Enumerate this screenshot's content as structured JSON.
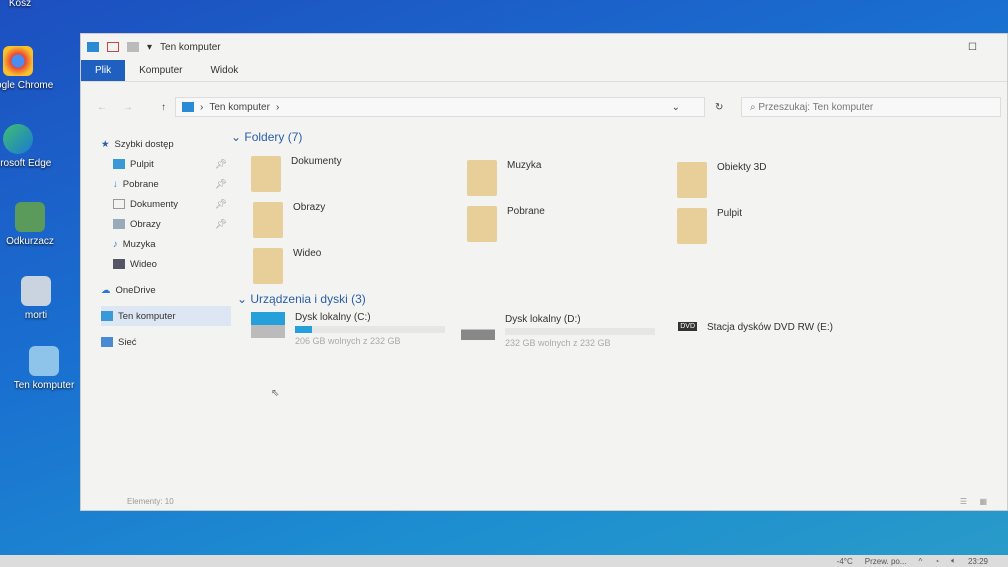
{
  "desktop": {
    "icons": [
      {
        "label": "Kosz"
      },
      {
        "label": "Google Chrome"
      },
      {
        "label": "Microsoft Edge"
      },
      {
        "label": "Odkurzacz"
      },
      {
        "label": "morti"
      },
      {
        "label": "Ten komputer"
      }
    ]
  },
  "window": {
    "title": "Ten komputer",
    "qa_dropdown": "▾",
    "ribbon": [
      "Plik",
      "Komputer",
      "Widok"
    ],
    "address": {
      "path": "Ten komputer",
      "sep": "›"
    },
    "search_placeholder": "Przeszukaj: Ten komputer",
    "nav": {
      "quick_access": "Szybki dostęp",
      "items": [
        {
          "label": "Pulpit",
          "pinned": true
        },
        {
          "label": "Pobrane",
          "pinned": true
        },
        {
          "label": "Dokumenty",
          "pinned": true
        },
        {
          "label": "Obrazy",
          "pinned": true
        },
        {
          "label": "Muzyka"
        },
        {
          "label": "Wideo"
        }
      ],
      "onedrive": "OneDrive",
      "this_pc": "Ten komputer",
      "network": "Sieć"
    },
    "folders_header": "Foldery (7)",
    "folders": [
      {
        "name": "Dokumenty"
      },
      {
        "name": "Muzyka"
      },
      {
        "name": "Obiekty 3D"
      },
      {
        "name": "Obrazy"
      },
      {
        "name": "Pobrane"
      },
      {
        "name": "Pulpit"
      },
      {
        "name": "Wideo"
      }
    ],
    "devices_header": "Urządzenia i dyski (3)",
    "devices": [
      {
        "name": "Dysk lokalny (C:)",
        "free": "206 GB wolnych z 232 GB",
        "used_fraction": 0.11
      },
      {
        "name": "Dysk lokalny (D:)",
        "free": "232 GB wolnych z 232 GB",
        "used_fraction": 0.0
      },
      {
        "name": "Stacja dysków DVD RW (E:)",
        "badge": "DVD"
      }
    ],
    "status": "Elementy: 10"
  },
  "taskbar": {
    "weather": "-4°C",
    "weather_text": "Przew. po...",
    "time": "23:29"
  },
  "colors": {
    "accent": "#1f5fbf",
    "header": "#2a5ea8",
    "drive_bar": "#26a0da"
  }
}
